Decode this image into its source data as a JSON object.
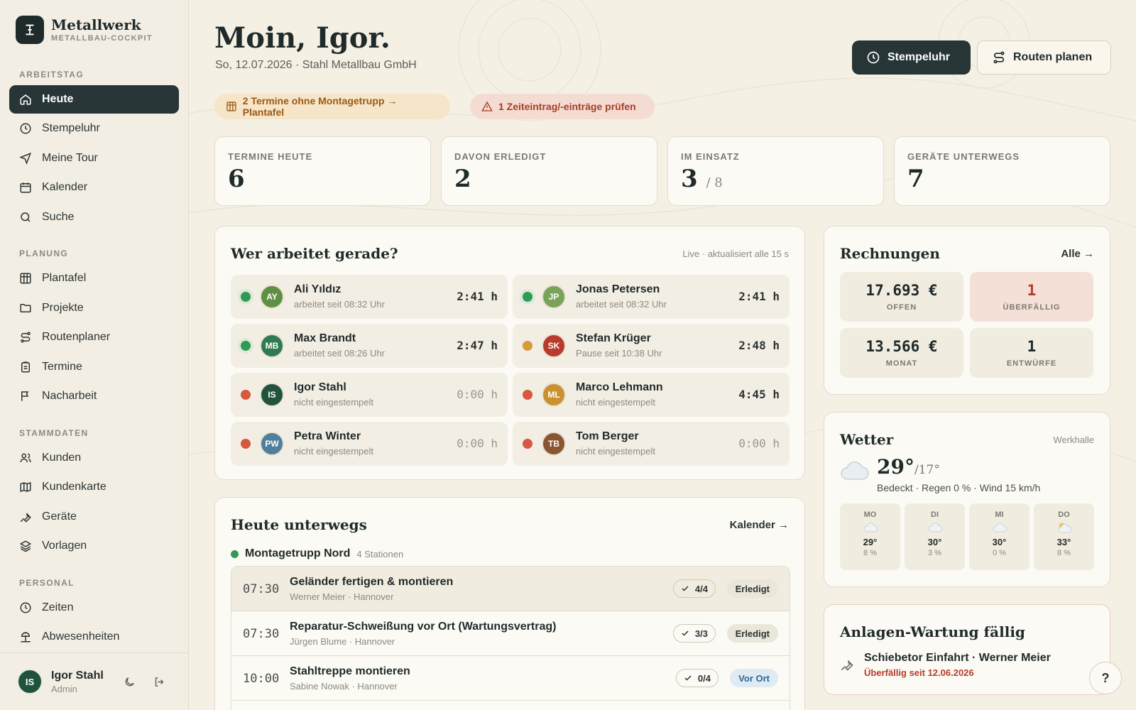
{
  "brand": {
    "name": "Metallwerk",
    "subtitle": "METALLBAU-COCKPIT"
  },
  "nav": {
    "sections": [
      "ARBEITSTAG",
      "PLANUNG",
      "STAMMDATEN",
      "PERSONAL"
    ],
    "items": [
      {
        "label": "Heute",
        "icon": "home-icon",
        "active": true
      },
      {
        "label": "Stempeluhr",
        "icon": "clock-icon"
      },
      {
        "label": "Meine Tour",
        "icon": "navigation-icon"
      },
      {
        "label": "Kalender",
        "icon": "calendar-icon"
      },
      {
        "label": "Suche",
        "icon": "search-icon"
      },
      {
        "label": "Plantafel",
        "icon": "grid-icon"
      },
      {
        "label": "Projekte",
        "icon": "folder-icon"
      },
      {
        "label": "Routenplaner",
        "icon": "route-icon"
      },
      {
        "label": "Termine",
        "icon": "clipboard-icon"
      },
      {
        "label": "Nacharbeit",
        "icon": "flag-icon"
      },
      {
        "label": "Kunden",
        "icon": "users-icon"
      },
      {
        "label": "Kundenkarte",
        "icon": "map-icon"
      },
      {
        "label": "Geräte",
        "icon": "wrench-icon"
      },
      {
        "label": "Vorlagen",
        "icon": "layers-icon"
      },
      {
        "label": "Zeiten",
        "icon": "clock-icon"
      },
      {
        "label": "Abwesenheiten",
        "icon": "beach-icon"
      }
    ]
  },
  "user": {
    "initials": "IS",
    "name": "Igor Stahl",
    "role": "Admin"
  },
  "header": {
    "greeting": "Moin, Igor.",
    "subline": "So, 12.07.2026 · Stahl Metallbau GmbH",
    "btn_clock": "Stempeluhr",
    "btn_routes": "Routen planen"
  },
  "alerts": [
    {
      "text": "2 Termine ohne Montagetrupp → Plantafel",
      "icon": "grid-icon"
    },
    {
      "text": "1 Zeiteintrag/-einträge prüfen",
      "icon": "warning-icon"
    }
  ],
  "stats": [
    {
      "label": "TERMINE HEUTE",
      "value": "6",
      "suffix": ""
    },
    {
      "label": "DAVON ERLEDIGT",
      "value": "2",
      "suffix": ""
    },
    {
      "label": "IM EINSATZ",
      "value": "3",
      "suffix": "/ 8"
    },
    {
      "label": "GERÄTE UNTERWEGS",
      "value": "7",
      "suffix": ""
    }
  ],
  "workers_card": {
    "title": "Wer arbeitet gerade?",
    "note": "Live · aktualisiert alle 15 s",
    "workers": [
      {
        "initials": "AY",
        "name": "Ali Yıldız",
        "status": "arbeitet seit 08:32 Uhr",
        "time": "2:41 h",
        "state": "working",
        "avatar_color": "#5f8f43"
      },
      {
        "initials": "JP",
        "name": "Jonas Petersen",
        "status": "arbeitet seit 08:32 Uhr",
        "time": "2:41 h",
        "state": "working",
        "avatar_color": "#7aa35a"
      },
      {
        "initials": "MB",
        "name": "Max Brandt",
        "status": "arbeitet seit 08:26 Uhr",
        "time": "2:47 h",
        "state": "working",
        "avatar_color": "#2f7a52"
      },
      {
        "initials": "SK",
        "name": "Stefan Krüger",
        "status": "Pause seit 10:38 Uhr",
        "time": "2:48 h",
        "state": "pause",
        "avatar_color": "#b83b2b"
      },
      {
        "initials": "IS",
        "name": "Igor Stahl",
        "status": "nicht eingestempelt",
        "time": "0:00 h",
        "state": "off",
        "avatar_color": "#21523d"
      },
      {
        "initials": "ML",
        "name": "Marco Lehmann",
        "status": "nicht eingestempelt",
        "time": "4:45 h",
        "state": "off",
        "avatar_color": "#c9922f"
      },
      {
        "initials": "PW",
        "name": "Petra Winter",
        "status": "nicht eingestempelt",
        "time": "0:00 h",
        "state": "off",
        "avatar_color": "#4f7f9d"
      },
      {
        "initials": "TB",
        "name": "Tom Berger",
        "status": "nicht eingestempelt",
        "time": "0:00 h",
        "state": "off",
        "avatar_color": "#8a5531"
      }
    ]
  },
  "trips_card": {
    "title": "Heute unterwegs",
    "link": "Kalender →",
    "team": "Montagetrupp Nord",
    "team_stations": "4 Stationen",
    "trips": [
      {
        "time": "07:30",
        "title": "Geländer fertigen & montieren",
        "sub": "Werner Meier · Hannover",
        "count": "4/4",
        "badge": "Erledigt",
        "badge_type": "done"
      },
      {
        "time": "07:30",
        "title": "Reparatur-Schweißung vor Ort (Wartungsvertrag)",
        "sub": "Jürgen Blume · Hannover",
        "count": "3/3",
        "badge": "Erledigt",
        "badge_type": "done"
      },
      {
        "time": "10:00",
        "title": "Stahltreppe montieren",
        "sub": "Sabine Nowak · Hannover",
        "count": "0/4",
        "badge": "Vor Ort",
        "badge_type": "onsite"
      }
    ]
  },
  "invoices": {
    "title": "Rechnungen",
    "link": "Alle →",
    "tiles": [
      {
        "value": "17.693 €",
        "label": "OFFEN"
      },
      {
        "value": "1",
        "label": "ÜBERFÄLLIG"
      },
      {
        "value": "13.566 €",
        "label": "MONAT"
      },
      {
        "value": "1",
        "label": "ENTWÜRFE"
      }
    ]
  },
  "weather": {
    "title": "Wetter",
    "location": "Werkhalle",
    "temp": "29°",
    "low": "/17°",
    "desc": "Bedeckt · Regen 0 % · Wind 15 km/h",
    "days": [
      {
        "day": "MO",
        "temp": "29°",
        "rain": "8 %",
        "icon": "cloud-icon"
      },
      {
        "day": "DI",
        "temp": "30°",
        "rain": "3 %",
        "icon": "cloud-icon"
      },
      {
        "day": "MI",
        "temp": "30°",
        "rain": "0 %",
        "icon": "cloud-icon"
      },
      {
        "day": "DO",
        "temp": "33°",
        "rain": "8 %",
        "icon": "sun-cloud-icon"
      }
    ]
  },
  "maintenance": {
    "title": "Anlagen-Wartung fällig",
    "item": "Schiebetor Einfahrt · Werner Meier",
    "due": "Überfällig seit 12.06.2026"
  },
  "help": "?",
  "colors": {
    "accent_dark": "#283536",
    "working": "#2f9a55",
    "pause": "#d89a3a",
    "off": "#d6583e",
    "danger": "#b83b2b"
  }
}
